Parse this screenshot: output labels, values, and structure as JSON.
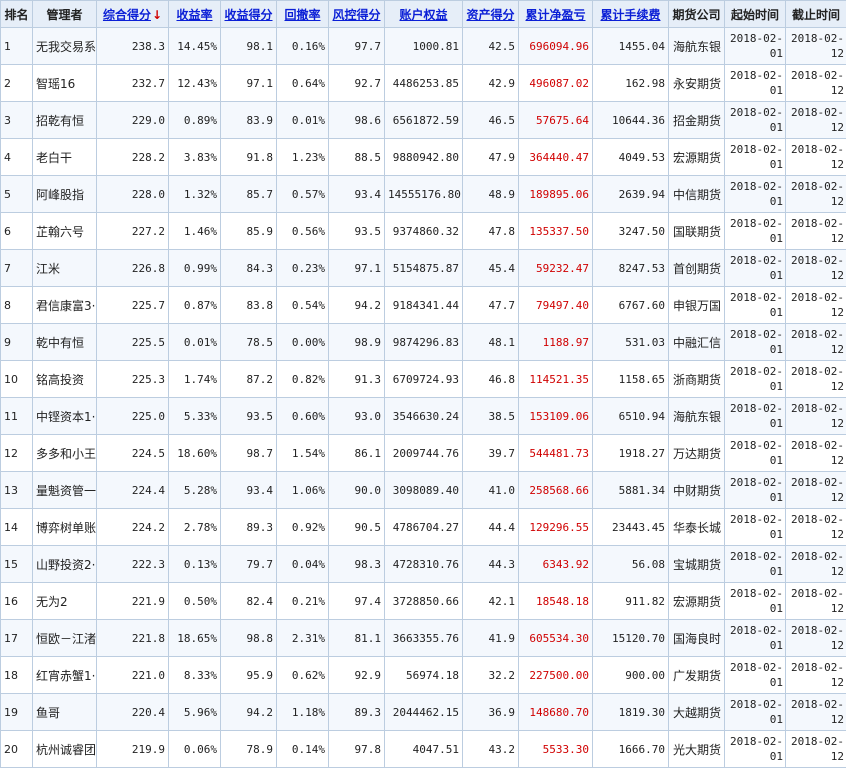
{
  "sort_arrow": "↓",
  "columns": [
    {
      "key": "rank",
      "label": "排名",
      "link": false
    },
    {
      "key": "manager",
      "label": "管理者",
      "link": false
    },
    {
      "key": "score",
      "label": "综合得分",
      "link": true
    },
    {
      "key": "return_rate",
      "label": "收益率",
      "link": true
    },
    {
      "key": "return_score",
      "label": "收益得分",
      "link": true
    },
    {
      "key": "drawdown",
      "label": "回撤率",
      "link": true
    },
    {
      "key": "risk_score",
      "label": "风控得分",
      "link": true
    },
    {
      "key": "equity",
      "label": "账户权益",
      "link": true
    },
    {
      "key": "asset_score",
      "label": "资产得分",
      "link": true
    },
    {
      "key": "net_profit",
      "label": "累计净盈亏",
      "link": true
    },
    {
      "key": "fees",
      "label": "累计手续费",
      "link": true
    },
    {
      "key": "company",
      "label": "期货公司",
      "link": false
    },
    {
      "key": "start",
      "label": "起始时间",
      "link": false
    },
    {
      "key": "end",
      "label": "截止时间",
      "link": false
    }
  ],
  "rows": [
    [
      "1",
      "无我交易系",
      "238.3",
      "14.45%",
      "98.1",
      "0.16%",
      "97.7",
      "1000.81",
      "42.5",
      "696094.96",
      "1455.04",
      "海航东银",
      "2018-02-01",
      "2018-02-12"
    ],
    [
      "2",
      "智瑶16",
      "232.7",
      "12.43%",
      "97.1",
      "0.64%",
      "92.7",
      "4486253.85",
      "42.9",
      "496087.02",
      "162.98",
      "永安期货",
      "2018-02-01",
      "2018-02-12"
    ],
    [
      "3",
      "招乾有恒",
      "229.0",
      "0.89%",
      "83.9",
      "0.01%",
      "98.6",
      "6561872.59",
      "46.5",
      "57675.64",
      "10644.36",
      "招金期货",
      "2018-02-01",
      "2018-02-12"
    ],
    [
      "4",
      "老白干",
      "228.2",
      "3.83%",
      "91.8",
      "1.23%",
      "88.5",
      "9880942.80",
      "47.9",
      "364440.47",
      "4049.53",
      "宏源期货",
      "2018-02-01",
      "2018-02-12"
    ],
    [
      "5",
      "阿峰股指",
      "228.0",
      "1.32%",
      "85.7",
      "0.57%",
      "93.4",
      "14555176.80",
      "48.9",
      "189895.06",
      "2639.94",
      "中信期货",
      "2018-02-01",
      "2018-02-12"
    ],
    [
      "6",
      "芷翰六号",
      "227.2",
      "1.46%",
      "85.9",
      "0.56%",
      "93.5",
      "9374860.32",
      "47.8",
      "135337.50",
      "3247.50",
      "国联期货",
      "2018-02-01",
      "2018-02-12"
    ],
    [
      "7",
      "江米",
      "226.8",
      "0.99%",
      "84.3",
      "0.23%",
      "97.1",
      "5154875.87",
      "45.4",
      "59232.47",
      "8247.53",
      "首创期货",
      "2018-02-01",
      "2018-02-12"
    ],
    [
      "8",
      "君信康富3·",
      "225.7",
      "0.87%",
      "83.8",
      "0.54%",
      "94.2",
      "9184341.44",
      "47.7",
      "79497.40",
      "6767.60",
      "申银万国",
      "2018-02-01",
      "2018-02-12"
    ],
    [
      "9",
      "乾中有恒",
      "225.5",
      "0.01%",
      "78.5",
      "0.00%",
      "98.9",
      "9874296.83",
      "48.1",
      "1188.97",
      "531.03",
      "中融汇信",
      "2018-02-01",
      "2018-02-12"
    ],
    [
      "10",
      "铭高投资",
      "225.3",
      "1.74%",
      "87.2",
      "0.82%",
      "91.3",
      "6709724.93",
      "46.8",
      "114521.35",
      "1158.65",
      "浙商期货",
      "2018-02-01",
      "2018-02-12"
    ],
    [
      "11",
      "中铿资本1·",
      "225.0",
      "5.33%",
      "93.5",
      "0.60%",
      "93.0",
      "3546630.24",
      "38.5",
      "153109.06",
      "6510.94",
      "海航东银",
      "2018-02-01",
      "2018-02-12"
    ],
    [
      "12",
      "多多和小王",
      "224.5",
      "18.60%",
      "98.7",
      "1.54%",
      "86.1",
      "2009744.76",
      "39.7",
      "544481.73",
      "1918.27",
      "万达期货",
      "2018-02-01",
      "2018-02-12"
    ],
    [
      "13",
      "量魁资管一",
      "224.4",
      "5.28%",
      "93.4",
      "1.06%",
      "90.0",
      "3098089.40",
      "41.0",
      "258568.66",
      "5881.34",
      "中财期货",
      "2018-02-01",
      "2018-02-12"
    ],
    [
      "14",
      "博弈树单账",
      "224.2",
      "2.78%",
      "89.3",
      "0.92%",
      "90.5",
      "4786704.27",
      "44.4",
      "129296.55",
      "23443.45",
      "华泰长城",
      "2018-02-01",
      "2018-02-12"
    ],
    [
      "15",
      "山野投资2·",
      "222.3",
      "0.13%",
      "79.7",
      "0.04%",
      "98.3",
      "4728310.76",
      "44.3",
      "6343.92",
      "56.08",
      "宝城期货",
      "2018-02-01",
      "2018-02-12"
    ],
    [
      "16",
      "无为2",
      "221.9",
      "0.50%",
      "82.4",
      "0.21%",
      "97.4",
      "3728850.66",
      "42.1",
      "18548.18",
      "911.82",
      "宏源期货",
      "2018-02-01",
      "2018-02-12"
    ],
    [
      "17",
      "恒欧－江渚",
      "221.8",
      "18.65%",
      "98.8",
      "2.31%",
      "81.1",
      "3663355.76",
      "41.9",
      "605534.30",
      "15120.70",
      "国海良时",
      "2018-02-01",
      "2018-02-12"
    ],
    [
      "18",
      "红宵赤蟹1·",
      "221.0",
      "8.33%",
      "95.9",
      "0.62%",
      "92.9",
      "56974.18",
      "32.2",
      "227500.00",
      "900.00",
      "广发期货",
      "2018-02-01",
      "2018-02-12"
    ],
    [
      "19",
      "鱼哥",
      "220.4",
      "5.96%",
      "94.2",
      "1.18%",
      "89.3",
      "2044462.15",
      "36.9",
      "148680.70",
      "1819.30",
      "大越期货",
      "2018-02-01",
      "2018-02-12"
    ],
    [
      "20",
      "杭州诚睿团",
      "219.9",
      "0.06%",
      "78.9",
      "0.14%",
      "97.8",
      "4047.51",
      "43.2",
      "5533.30",
      "1666.70",
      "光大期货",
      "2018-02-01",
      "2018-02-12"
    ]
  ]
}
